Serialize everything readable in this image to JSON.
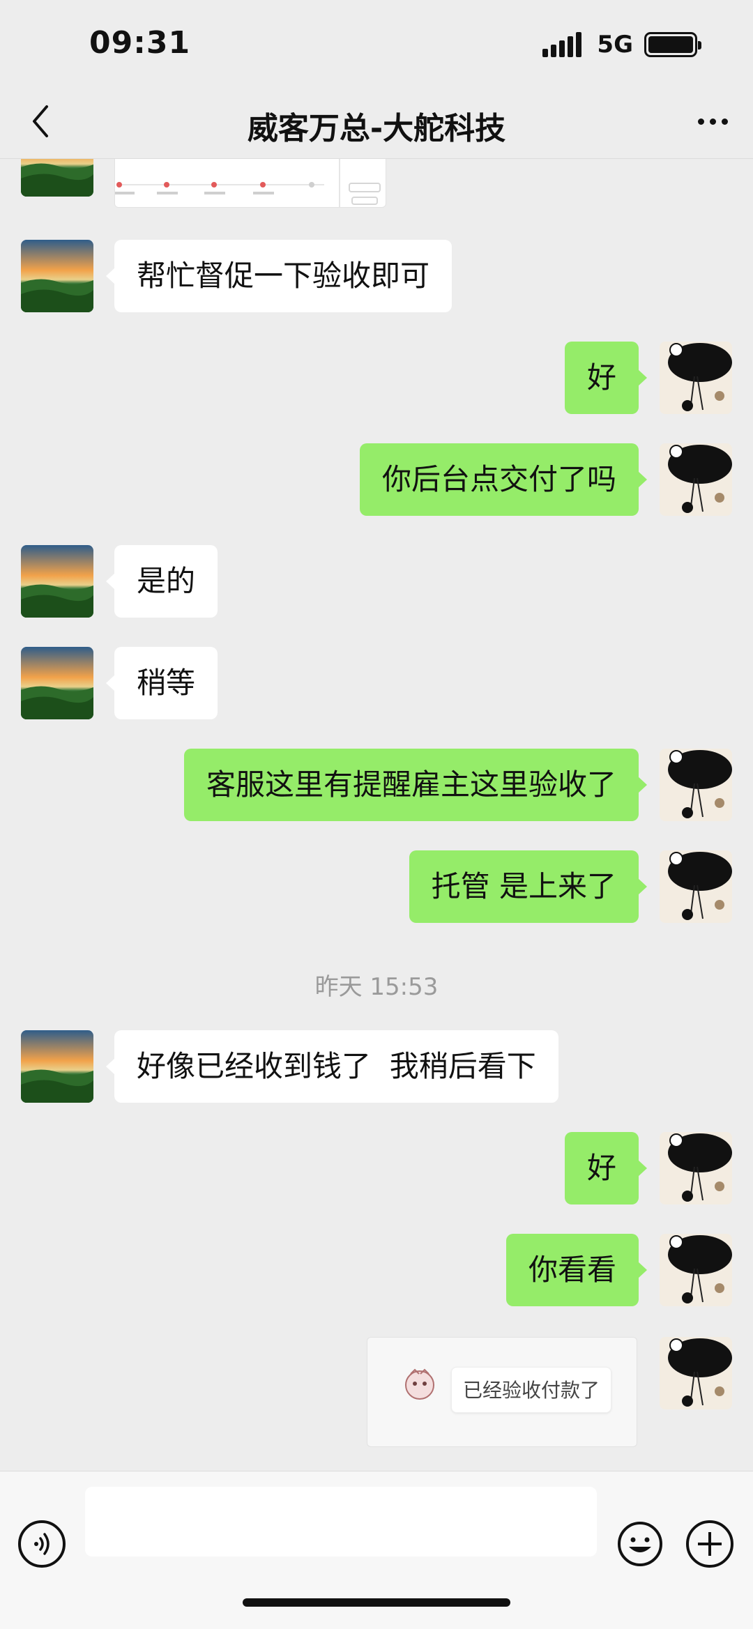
{
  "status_bar": {
    "time": "09:31",
    "network": "5G",
    "icons": [
      "signal-icon",
      "battery-icon"
    ]
  },
  "header": {
    "title": "威客万总-大舵科技",
    "back_icon": "chevron-left-icon",
    "more_icon": "more-dots-icon"
  },
  "messages": [
    {
      "side": "left",
      "type": "image",
      "description_icon": "screenshot-thumbnail"
    },
    {
      "side": "left",
      "type": "text",
      "text": "帮忙督促一下验收即可"
    },
    {
      "side": "right",
      "type": "text",
      "text": "好"
    },
    {
      "side": "right",
      "type": "text",
      "text": "你后台点交付了吗"
    },
    {
      "side": "left",
      "type": "text",
      "text": "是的"
    },
    {
      "side": "left",
      "type": "text",
      "text": "稍等"
    },
    {
      "side": "right",
      "type": "text",
      "text": "客服这里有提醒雇主这里验收了"
    },
    {
      "side": "right",
      "type": "text",
      "text": "托管 是上来了"
    },
    {
      "type": "timestamp",
      "text": "昨天 15:53"
    },
    {
      "side": "left",
      "type": "text",
      "text": "好像已经收到钱了  我稍后看下"
    },
    {
      "side": "right",
      "type": "text",
      "text": "好"
    },
    {
      "side": "right",
      "type": "text",
      "text": "你看看"
    },
    {
      "side": "right",
      "type": "image",
      "quoted_text": "已经验收付款了"
    }
  ],
  "input_bar": {
    "placeholder": "",
    "voice_icon": "voice-icon",
    "emoji_icon": "emoji-icon",
    "plus_icon": "plus-icon"
  },
  "colors": {
    "background": "#ededed",
    "sent_bubble": "#95ec69",
    "received_bubble": "#ffffff",
    "timestamp": "#9a9a9a"
  }
}
